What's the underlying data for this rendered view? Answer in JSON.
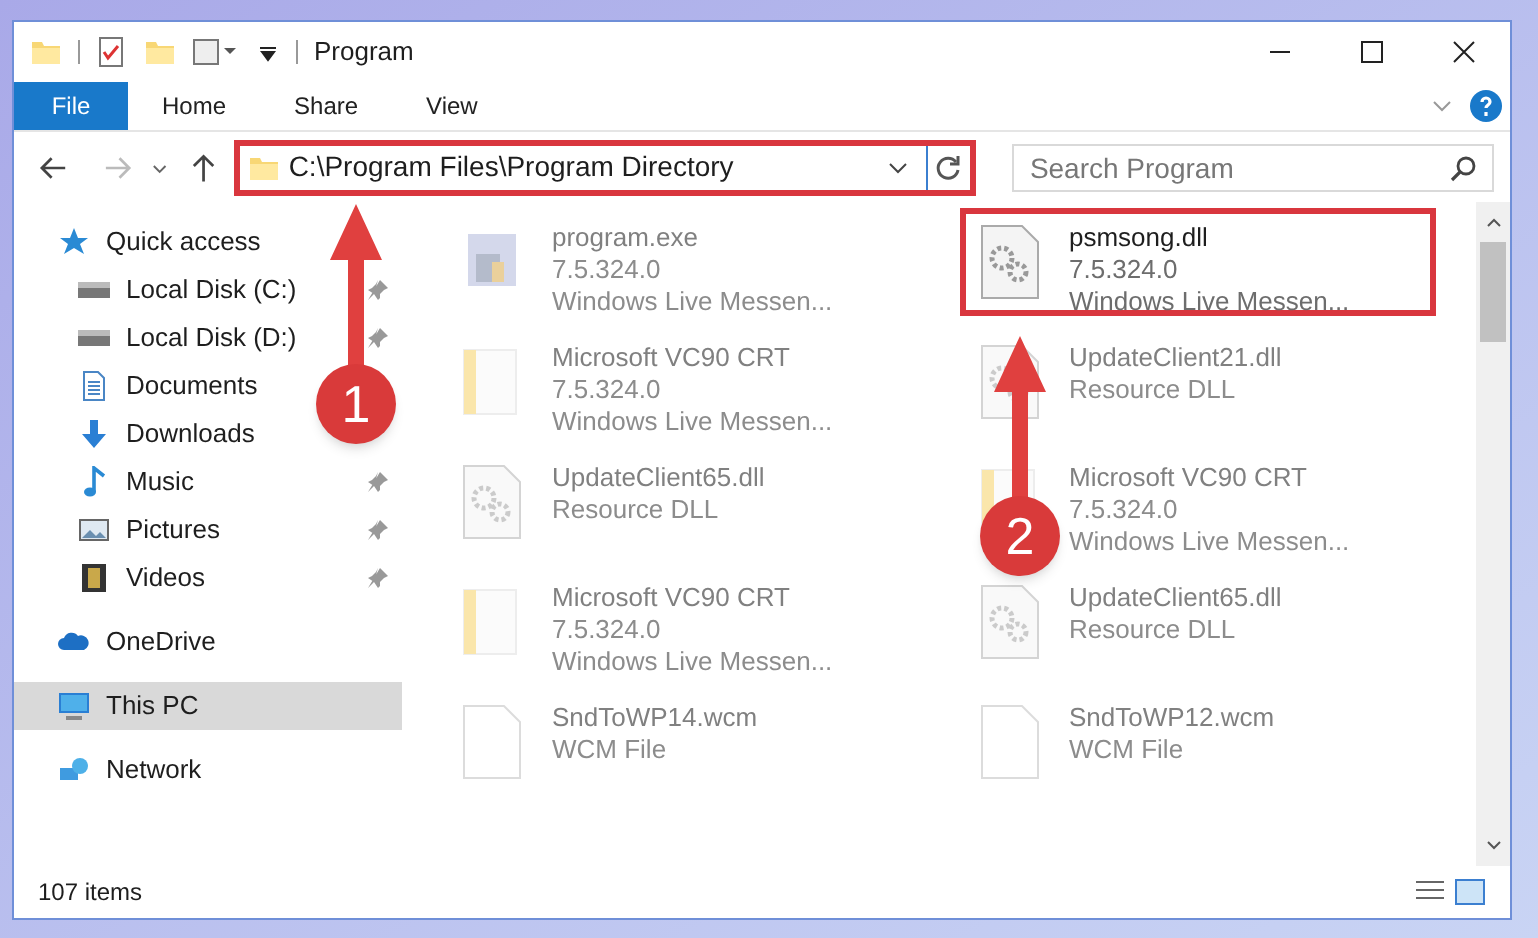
{
  "window": {
    "title": "Program"
  },
  "ribbon_tabs": [
    {
      "label": "File",
      "selected": true
    },
    {
      "label": "Home",
      "selected": false
    },
    {
      "label": "Share",
      "selected": false
    },
    {
      "label": "View",
      "selected": false
    }
  ],
  "address": {
    "path": "C:\\Program Files\\Program Directory",
    "highlighted": true
  },
  "search": {
    "placeholder": "Search Program"
  },
  "nav": [
    {
      "label": "Quick access",
      "kind": "star",
      "pinned": false,
      "selected": false,
      "children": [
        {
          "label": "Local Disk (C:)",
          "kind": "drive",
          "pinned": true,
          "selected": false
        },
        {
          "label": "Local Disk (D:)",
          "kind": "drive",
          "pinned": true,
          "selected": false
        },
        {
          "label": "Documents",
          "kind": "document",
          "selected": false
        },
        {
          "label": "Downloads",
          "kind": "download",
          "selected": false
        },
        {
          "label": "Music",
          "kind": "music",
          "pinned": true,
          "selected": false
        },
        {
          "label": "Pictures",
          "kind": "pictures",
          "pinned": true,
          "selected": false
        },
        {
          "label": "Videos",
          "kind": "video",
          "pinned": true,
          "selected": false
        }
      ]
    },
    {
      "label": "OneDrive",
      "kind": "cloud",
      "pinned": false,
      "selected": false
    },
    {
      "label": "This PC",
      "kind": "pc",
      "pinned": false,
      "selected": true
    },
    {
      "label": "Network",
      "kind": "network",
      "pinned": false,
      "selected": false
    }
  ],
  "files": [
    {
      "name": "program.exe",
      "details": [
        "7.5.324.0",
        "Windows Live Messen..."
      ],
      "kind": "exe",
      "blurred": true,
      "highlighted": false
    },
    {
      "name": "psmsong.dll",
      "details": [
        "7.5.324.0",
        "Windows Live Messen..."
      ],
      "kind": "dll",
      "blurred": false,
      "highlighted": true
    },
    {
      "name": "Microsoft VC90 CRT",
      "details": [
        "7.5.324.0",
        "Windows Live Messen..."
      ],
      "kind": "folder",
      "blurred": true,
      "highlighted": false
    },
    {
      "name": "UpdateClient21.dll",
      "details": [
        "Resource DLL"
      ],
      "kind": "dll",
      "blurred": true,
      "highlighted": false
    },
    {
      "name": "UpdateClient65.dll",
      "details": [
        "Resource DLL"
      ],
      "kind": "dll",
      "blurred": true,
      "highlighted": false
    },
    {
      "name": "Microsoft VC90 CRT",
      "details": [
        "7.5.324.0",
        "Windows Live Messen..."
      ],
      "kind": "folder",
      "blurred": true,
      "highlighted": false
    },
    {
      "name": "Microsoft VC90 CRT",
      "details": [
        "7.5.324.0",
        "Windows Live Messen..."
      ],
      "kind": "folder",
      "blurred": true,
      "highlighted": false
    },
    {
      "name": "UpdateClient65.dll",
      "details": [
        "Resource DLL"
      ],
      "kind": "dll",
      "blurred": true,
      "highlighted": false
    },
    {
      "name": "SndToWP14.wcm",
      "details": [
        "WCM File"
      ],
      "kind": "blank",
      "blurred": true,
      "highlighted": false
    },
    {
      "name": "SndToWP12.wcm",
      "details": [
        "WCM File"
      ],
      "kind": "blank",
      "blurred": true,
      "highlighted": false
    }
  ],
  "status_bar": {
    "item_count": "107 items"
  },
  "annotations": [
    {
      "number": "1"
    },
    {
      "number": "2"
    }
  ]
}
